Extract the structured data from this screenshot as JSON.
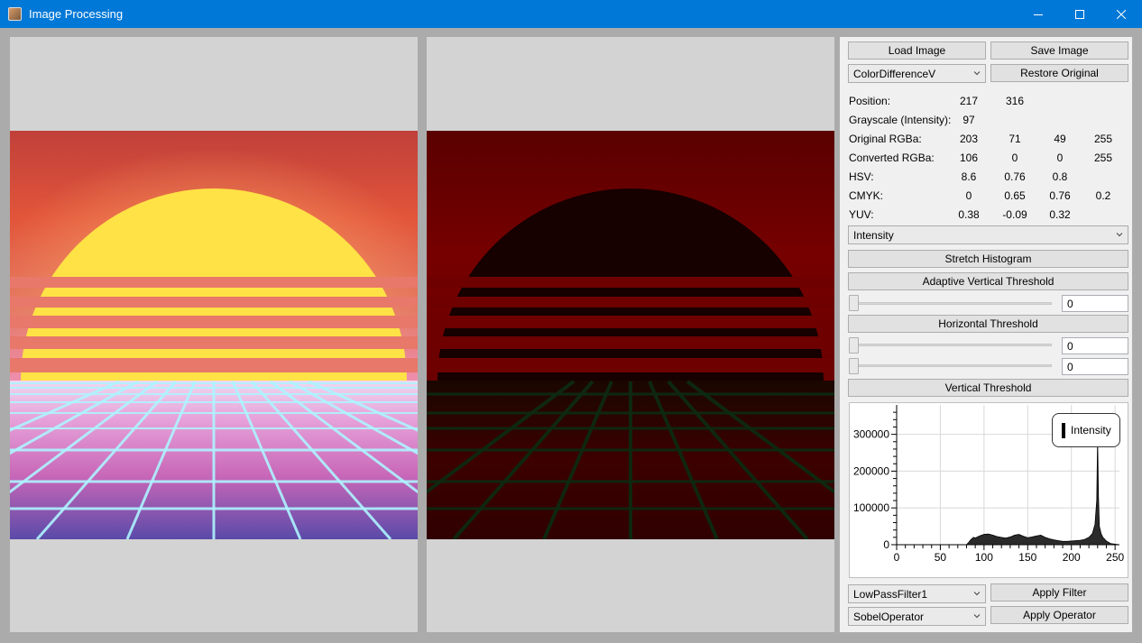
{
  "window": {
    "title": "Image Processing"
  },
  "controls": {
    "load_image": "Load Image",
    "save_image": "Save Image",
    "color_mode": "ColorDifferenceV",
    "restore_original": "Restore Original",
    "histogram_channel": "Intensity",
    "stretch_histogram": "Stretch Histogram",
    "adaptive_vertical_threshold": "Adaptive Vertical Threshold",
    "adaptive_value": "0",
    "horizontal_threshold": "Horizontal Threshold",
    "horizontal_value_1": "0",
    "horizontal_value_2": "0",
    "vertical_threshold": "Vertical Threshold",
    "filter_select": "LowPassFilter1",
    "apply_filter": "Apply Filter",
    "operator_select": "SobelOperator",
    "apply_operator": "Apply Operator"
  },
  "pixel_info": {
    "position": {
      "label": "Position:",
      "values": [
        "217",
        "316"
      ]
    },
    "grayscale": {
      "label": "Grayscale (Intensity):",
      "values": [
        "97"
      ]
    },
    "original": {
      "label": "Original RGBa:",
      "values": [
        "203",
        "71",
        "49",
        "255"
      ]
    },
    "converted": {
      "label": "Converted RGBa:",
      "values": [
        "106",
        "0",
        "0",
        "255"
      ]
    },
    "hsv": {
      "label": "HSV:",
      "values": [
        "8.6",
        "0.76",
        "0.8"
      ]
    },
    "cmyk": {
      "label": "CMYK:",
      "values": [
        "0",
        "0.65",
        "0.76",
        "0.2"
      ]
    },
    "yuv": {
      "label": "YUV:",
      "values": [
        "0.38",
        "-0.09",
        "0.32"
      ]
    }
  },
  "chart_data": {
    "type": "area",
    "title": "",
    "xlabel": "",
    "ylabel": "",
    "xlim": [
      0,
      255
    ],
    "ylim": [
      0,
      380000
    ],
    "x_ticks": [
      "0",
      "50",
      "100",
      "150",
      "200",
      "250"
    ],
    "y_ticks": [
      "0",
      "100000",
      "200000",
      "300000"
    ],
    "legend": "top-right",
    "series": [
      {
        "name": "Intensity",
        "x": [
          0,
          80,
          82,
          85,
          88,
          90,
          95,
          100,
          105,
          110,
          115,
          120,
          125,
          130,
          135,
          140,
          145,
          150,
          155,
          160,
          165,
          170,
          175,
          180,
          185,
          190,
          195,
          200,
          205,
          210,
          215,
          220,
          224,
          227,
          229,
          230,
          231,
          232,
          233,
          234,
          236,
          238,
          240,
          245,
          255
        ],
        "values": [
          0,
          0,
          5000,
          14000,
          20000,
          18000,
          24000,
          28000,
          29000,
          26000,
          22000,
          20000,
          18000,
          21000,
          26000,
          28000,
          23000,
          19000,
          21000,
          24000,
          26000,
          20000,
          16000,
          13000,
          11000,
          9000,
          9000,
          10000,
          11000,
          12000,
          14000,
          20000,
          30000,
          55000,
          120000,
          290000,
          130000,
          50000,
          40000,
          30000,
          20000,
          15000,
          10000,
          3000,
          0
        ]
      }
    ]
  }
}
